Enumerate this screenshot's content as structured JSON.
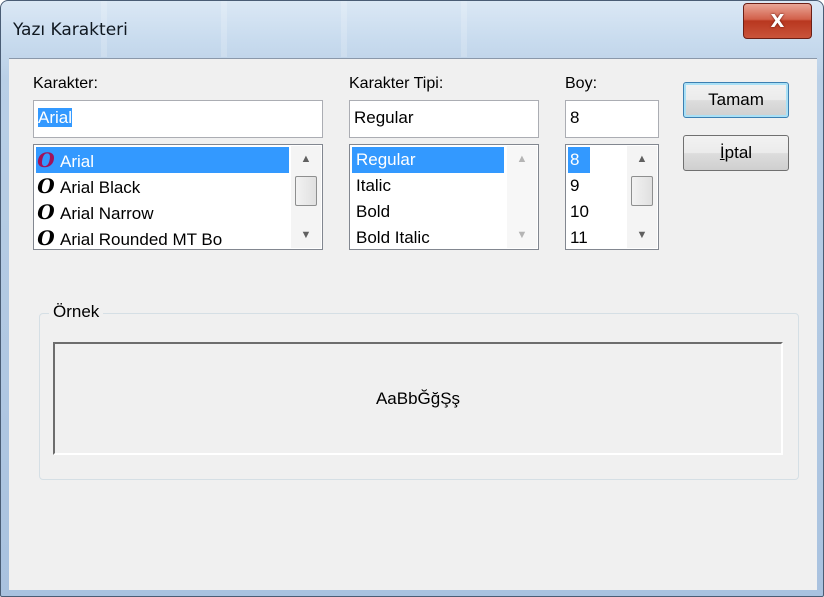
{
  "window": {
    "title": "Yazı Karakteri",
    "close_label": "X"
  },
  "font": {
    "label": "Karakter:",
    "value_selected": "Arial",
    "items": [
      {
        "icon": "opentype-icon",
        "glyph": "O",
        "label": "Arial",
        "selected": true
      },
      {
        "icon": "opentype-icon",
        "glyph": "O",
        "label": "Arial Black",
        "selected": false
      },
      {
        "icon": "opentype-icon",
        "glyph": "O",
        "label": "Arial Narrow",
        "selected": false
      },
      {
        "icon": "opentype-icon",
        "glyph": "O",
        "label": "Arial Rounded MT Bo",
        "selected": false
      }
    ]
  },
  "style": {
    "label": "Karakter Tipi:",
    "value": "Regular",
    "items": [
      {
        "label": "Regular",
        "selected": true
      },
      {
        "label": "Italic",
        "selected": false
      },
      {
        "label": "Bold",
        "selected": false
      },
      {
        "label": "Bold Italic",
        "selected": false
      }
    ]
  },
  "size": {
    "label": "Boy:",
    "value": "8",
    "items": [
      {
        "label": "8",
        "selected": true
      },
      {
        "label": "9",
        "selected": false
      },
      {
        "label": "10",
        "selected": false
      },
      {
        "label": "11",
        "selected": false
      }
    ]
  },
  "buttons": {
    "ok_label": "Tamam",
    "cancel_first": "İ",
    "cancel_rest": "ptal"
  },
  "sample": {
    "group_label": "Örnek",
    "text": "AaBbĞğŞş"
  },
  "scroll": {
    "up": "▲",
    "down": "▼"
  },
  "colors": {
    "selection": "#3399ff",
    "close_button": "#c9543b",
    "default_button_border": "#3c7fb1"
  }
}
